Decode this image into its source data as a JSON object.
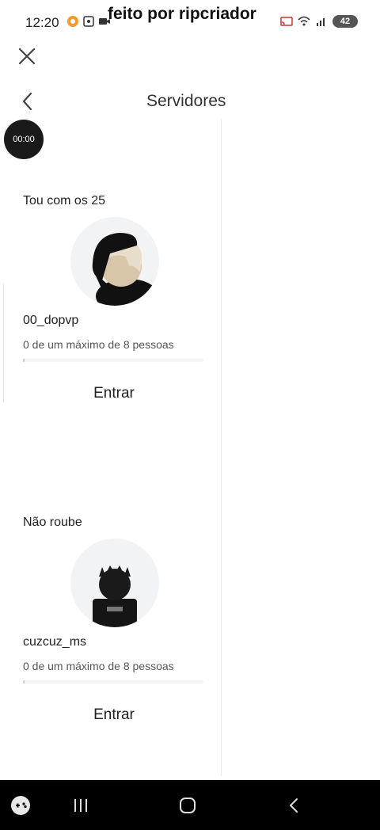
{
  "status_bar": {
    "time": "12:20",
    "watermark": "feito por ripcriador",
    "battery": "42"
  },
  "header": {
    "title": "Servidores"
  },
  "timer": {
    "value": "00:00"
  },
  "servers": [
    {
      "name": "Tou com os 25",
      "owner": "00_dopvp",
      "capacity": "0 de um máximo de 8 pessoas",
      "fill": 0.01,
      "join_label": "Entrar"
    },
    {
      "name": "Não roube",
      "owner": "cuzcuz_ms",
      "capacity": "0 de um máximo de 8 pessoas",
      "fill": 0.01,
      "join_label": "Entrar"
    }
  ],
  "icons": {
    "close": "close-icon",
    "back": "chevron-left-icon",
    "gamepad": "gamepad-icon",
    "recents": "recents-icon",
    "home": "home-icon",
    "nav_back": "nav-back-icon"
  }
}
